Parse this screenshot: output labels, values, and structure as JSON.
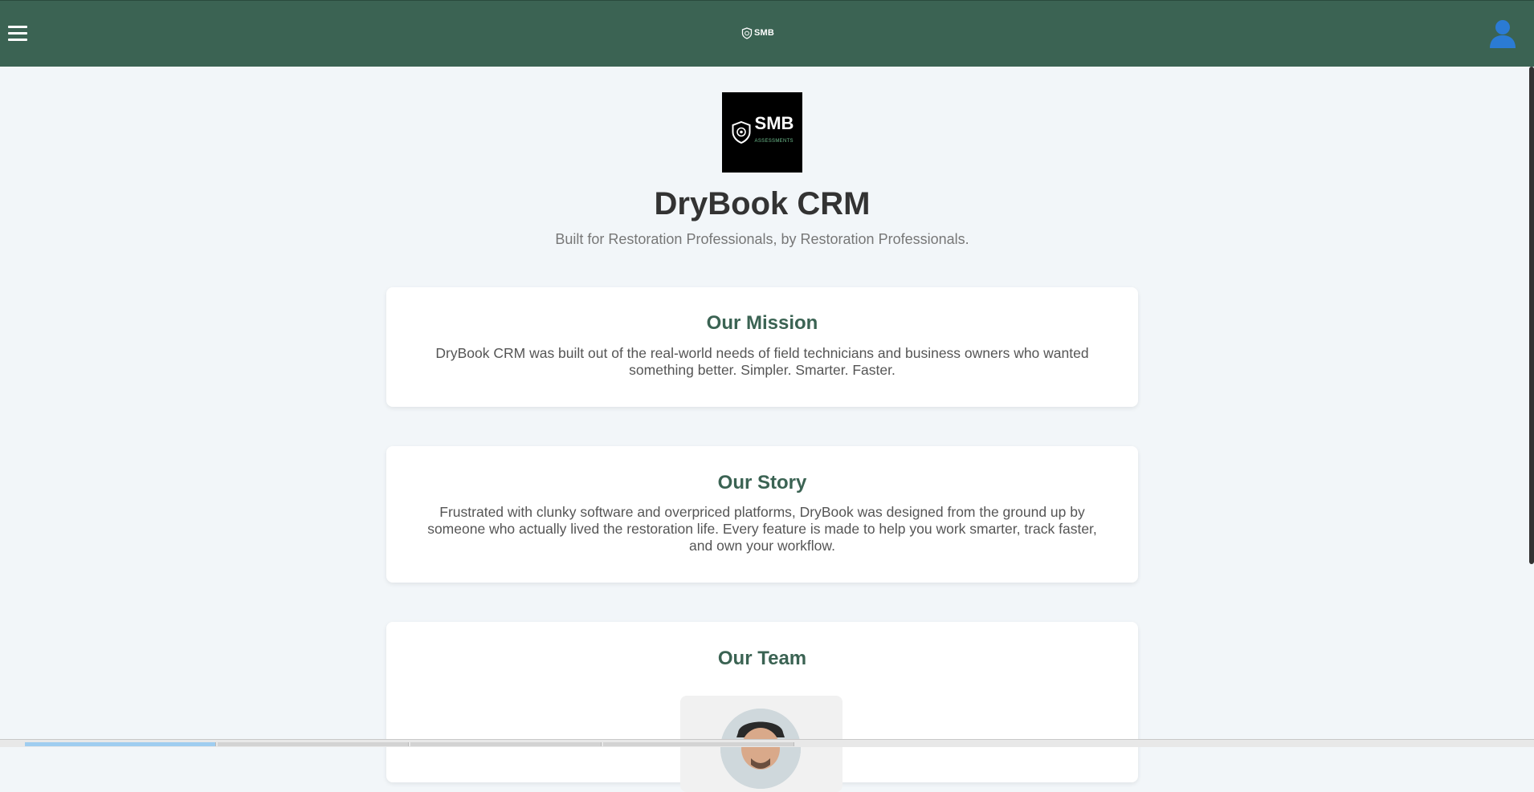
{
  "header": {
    "brand_text": "SMB",
    "menu_icon": "hamburger-menu-icon",
    "account_icon": "user-account-icon",
    "background_color": "#3b6353"
  },
  "hero": {
    "logo_brand": "SMB",
    "logo_subtext": "ASSESSMENTS",
    "title": "DryBook CRM",
    "tagline": "Built for Restoration Professionals, by Restoration Professionals."
  },
  "sections": {
    "mission": {
      "heading": "Our Mission",
      "body": "DryBook CRM was built out of the real-world needs of field technicians and business owners who wanted something better. Simpler. Smarter. Faster."
    },
    "story": {
      "heading": "Our Story",
      "body": "Frustrated with clunky software and overpriced platforms, DryBook was designed from the ground up by someone who actually lived the restoration life. Every feature is made to help you work smarter, track faster, and own your workflow."
    },
    "team": {
      "heading": "Our Team"
    }
  },
  "colors": {
    "accent": "#3b6353",
    "page_background": "#f2f6f9",
    "user_icon": "#2b7bd4"
  }
}
